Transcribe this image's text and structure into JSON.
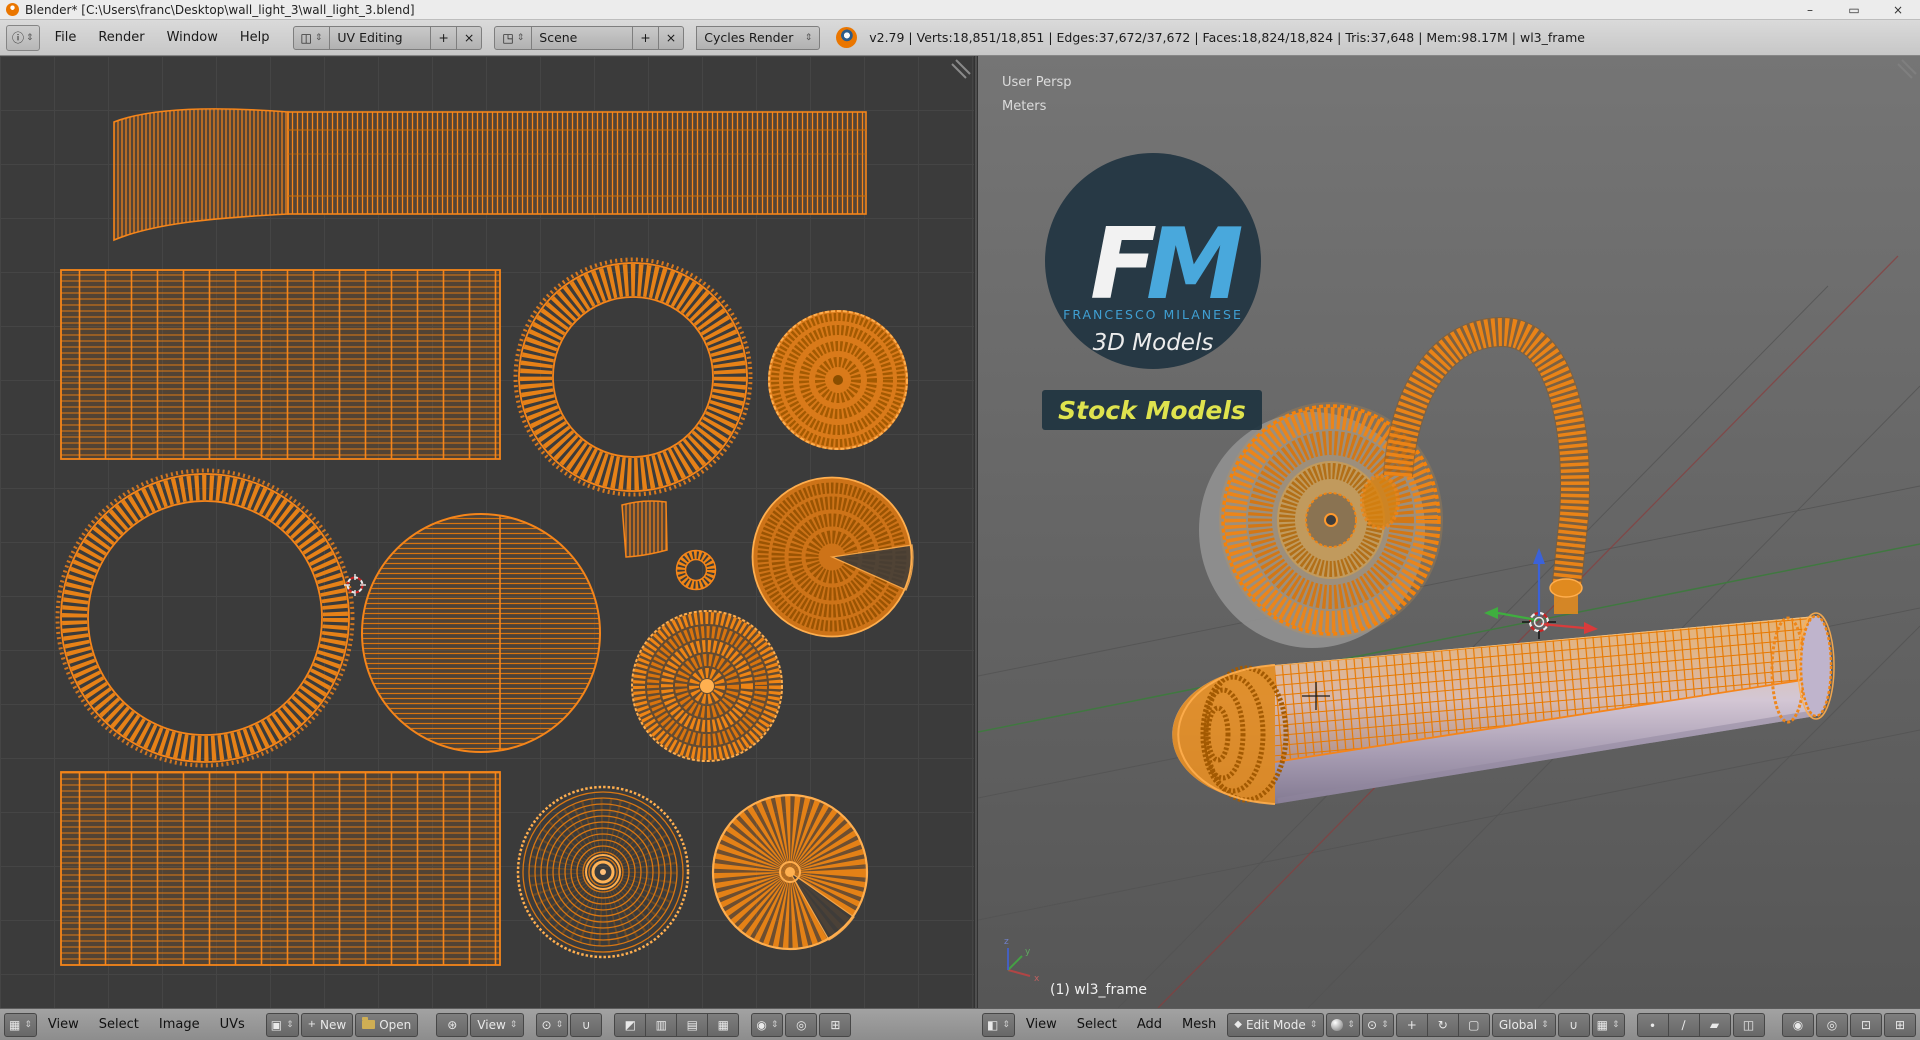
{
  "window": {
    "title": "Blender* [C:\\Users\\franc\\Desktop\\wall_light_3\\wall_light_3.blend]"
  },
  "topbar": {
    "menus": [
      "File",
      "Render",
      "Window",
      "Help"
    ],
    "workspace": "UV Editing",
    "scene": "Scene",
    "engine": "Cycles Render",
    "stats": "v2.79 | Verts:18,851/18,851 | Edges:37,672/37,672 | Faces:18,824/18,824 | Tris:37,648 | Mem:98.17M | wl3_frame"
  },
  "uv_editor": {
    "menus": [
      "View",
      "Select",
      "Image",
      "UVs"
    ],
    "new_button": "New",
    "open_button": "Open",
    "view_mode": "View"
  },
  "viewport": {
    "projection": "User Persp",
    "units": "Meters",
    "active_object": "(1) wl3_frame",
    "menus": [
      "View",
      "Select",
      "Add",
      "Mesh"
    ],
    "mode": "Edit Mode",
    "orientation": "Global",
    "axes": {
      "x": "x",
      "y": "y",
      "z": "z"
    },
    "logo": {
      "letter_f": "F",
      "letter_m": "M",
      "name": "FRANCESCO MILANESE",
      "tagline": "3D Models",
      "badge": "Stock Models"
    }
  },
  "icons": {
    "info": "ⓘ",
    "updown": "⇕",
    "plus": "+",
    "close": "×",
    "minimize": "–",
    "maximize": "▭",
    "layout": "◫",
    "scene": "◳",
    "uv_editor_type": "▦",
    "view3d_editor_type": "◧",
    "image": "▣",
    "pin": "⊛",
    "pivot": "⊙",
    "magnet": "∪",
    "snap_element": "▦",
    "select_vertex": "∙",
    "select_edge": "∕",
    "select_face": "▰",
    "occlusion": "◫",
    "proportional": "◉",
    "translate": "+",
    "rotate": "↻",
    "scale": "▢",
    "camera": "◎",
    "texture": "⊡",
    "grid": "⊞",
    "mode_icon": "◆",
    "uv_sync": "◩",
    "uv_vertex": "▥",
    "uv_edge": "▤",
    "uv_face": "▦"
  },
  "colors": {
    "uv_accent": "#f5851a",
    "logo_blue": "#49a8dc",
    "badge_text": "#dfe34e"
  }
}
